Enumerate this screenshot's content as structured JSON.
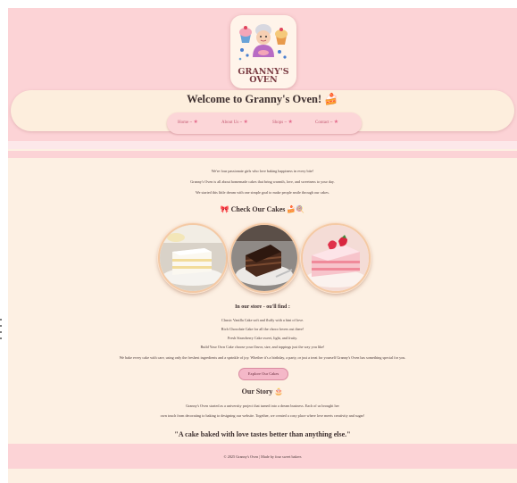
{
  "header": {
    "logo": {
      "line1": "GRANNY'S",
      "line2": "OVEN"
    },
    "welcome": "Welcome to Granny's Oven! 🍰"
  },
  "nav": {
    "items": [
      {
        "label": "Home ~",
        "icon": "star-icon"
      },
      {
        "label": "About Us ~",
        "icon": "star-icon"
      },
      {
        "label": "Shops ~",
        "icon": "star-icon"
      },
      {
        "label": "Contact ~",
        "icon": "star-icon"
      }
    ]
  },
  "intro": {
    "lines": [
      "We're four passionate girls who love baking happiness in every bite!",
      "Granny's Oven is all about homemade cakes that bring warmth, love, and sweetness to your day.",
      "We started this little dream with one simple goal to make people smile through our cakes."
    ]
  },
  "cakes": {
    "heading": "🎀 Check Our Cakes 🍰🍭",
    "images": [
      "vanilla-cake",
      "chocolate-cake",
      "strawberry-cake"
    ]
  },
  "store": {
    "heading": "In our store - ou'll find :",
    "items": [
      "Classic Vanilla Cake soft and fluffy with a hint of love.",
      "Rich Chocolate Cake for all the choco lovers out there!",
      "Fresh Strawberry Cake sweet, light, and fruity.",
      "Build Your Own Cake choose your flavor, size, and toppings just the way you like!"
    ],
    "note": "We bake every cake with care, using only the freshest ingredients and a sprinkle of joy. Whether it's a birthday, a party, or just a treat for yourself Granny's Oven has something special for you.",
    "button": "Explore Our Cakes"
  },
  "story": {
    "heading": "Our Story 🎂",
    "lines": [
      "Granny's Oven started as a university project that turned into a dream business. Each of us brought her",
      "own touch from decorating to baking to designing our website. Together, we created a cozy place where love meets creativity and sugar!"
    ],
    "quote": "\"A cake baked with love tastes better than anything else.\""
  },
  "footer": {
    "text": "© 2025 Granny's Oven | Made by four sweet bakers"
  },
  "colors": {
    "header_pink": "#fcd3d6",
    "cream": "#fdf0e3",
    "accent": "#e46a8c",
    "button": "#f4b8c8"
  }
}
